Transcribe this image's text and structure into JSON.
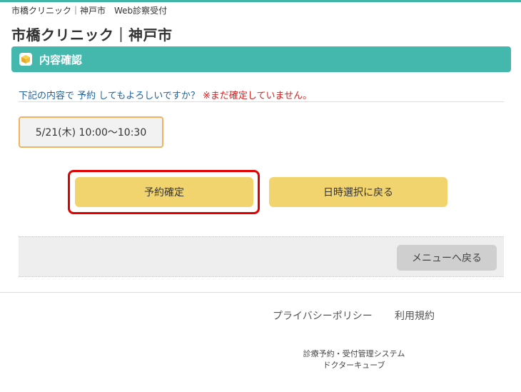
{
  "header": {
    "breadcrumb": "市橋クリニック｜神戸市　Web診察受付",
    "clinic_title": "市橋クリニック｜神戸市",
    "accent_color": "#45b8ad"
  },
  "section": {
    "icon": "cube-icon",
    "title": "内容確認"
  },
  "confirmation": {
    "question": "下記の内容で 予約 してもよろしいですか？",
    "warning": "※まだ確定していません。",
    "question_color": "#1f5f99",
    "warning_color": "#d62020"
  },
  "slot": {
    "datetime": "5/21(木) 10:00～10:30"
  },
  "actions": {
    "confirm_label": "予約確定",
    "back_to_date_label": "日時選択に戻る",
    "button_color": "#f2d46f",
    "highlight_color": "#e00000"
  },
  "menu": {
    "back_label": "メニューへ戻る"
  },
  "footer": {
    "privacy_label": "プライバシーポリシー",
    "terms_label": "利用規約",
    "system_line1": "診療予約・受付管理システム",
    "system_line2": "ドクターキューブ"
  }
}
